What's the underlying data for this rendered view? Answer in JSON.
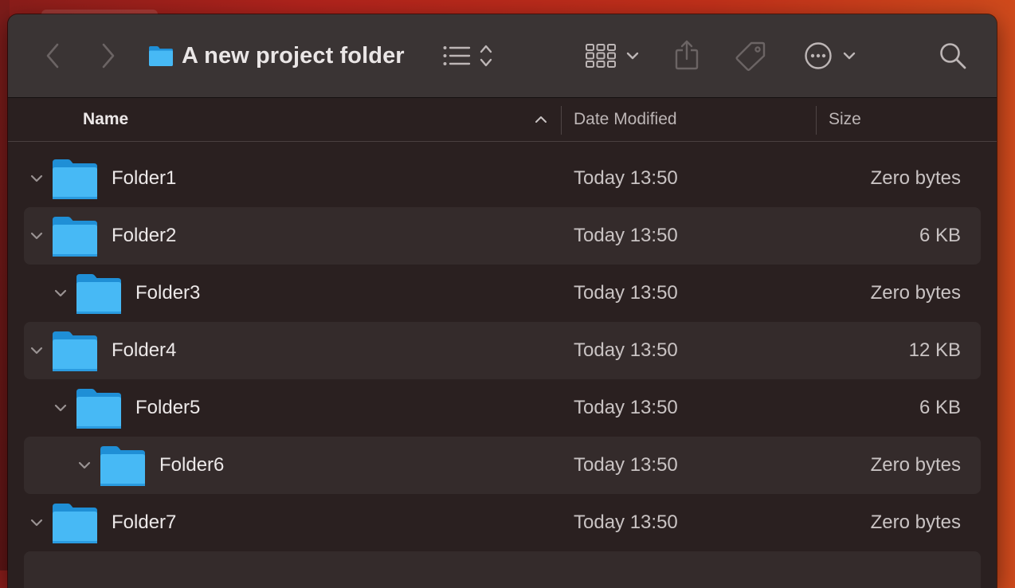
{
  "window": {
    "title": "A new project folder"
  },
  "toolbar": {
    "icons": [
      "chevron-left-icon",
      "chevron-right-icon",
      "folder-icon",
      "list-view-icon",
      "sort-updown-icon",
      "grid-view-icon",
      "share-icon",
      "tag-icon",
      "more-icon",
      "search-icon"
    ]
  },
  "columns": {
    "name": "Name",
    "date": "Date Modified",
    "size": "Size",
    "sort_icon": "sort-ascending-icon"
  },
  "rows": [
    {
      "name": "Folder1",
      "date": "Today 13:50",
      "size": "Zero bytes",
      "depth": 0,
      "expanded": true
    },
    {
      "name": "Folder2",
      "date": "Today 13:50",
      "size": "6 KB",
      "depth": 0,
      "expanded": true
    },
    {
      "name": "Folder3",
      "date": "Today 13:50",
      "size": "Zero bytes",
      "depth": 1,
      "expanded": true
    },
    {
      "name": "Folder4",
      "date": "Today 13:50",
      "size": "12 KB",
      "depth": 0,
      "expanded": true
    },
    {
      "name": "Folder5",
      "date": "Today 13:50",
      "size": "6 KB",
      "depth": 1,
      "expanded": true
    },
    {
      "name": "Folder6",
      "date": "Today 13:50",
      "size": "Zero bytes",
      "depth": 2,
      "expanded": true
    },
    {
      "name": "Folder7",
      "date": "Today 13:50",
      "size": "Zero bytes",
      "depth": 0,
      "expanded": true
    }
  ],
  "colors": {
    "folder_blue": "#3fb6f2",
    "window_bg": "#2a2020",
    "toolbar_bg": "#3a3434",
    "desktop_red": "#b0231c"
  }
}
